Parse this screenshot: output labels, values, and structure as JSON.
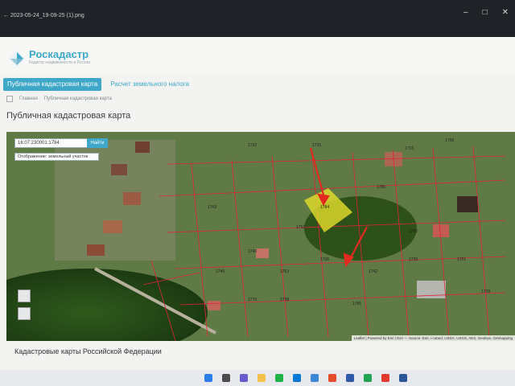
{
  "window": {
    "filename": "← 2023-05-24_19-09-25 (1).png"
  },
  "header": {
    "brand": "Роскадастр",
    "brand_sub": "Кадастр недвижимости в России"
  },
  "tabs": [
    {
      "label": "Публичная кадастровая карта",
      "active": true
    },
    {
      "label": "Расчет земельного налога",
      "active": false
    }
  ],
  "breadcrumb": {
    "home": "Главная",
    "current": "Публичная кадастровая карта"
  },
  "page_title": "Публичная кадастровая карта",
  "map": {
    "search_value": "16:07:230001:1784",
    "find_label": "Найти",
    "select_value": "Отображение: земельный участок",
    "parcel_labels": [
      "1722",
      "1725",
      "1716",
      "1768",
      "1784",
      "1752",
      "1706",
      "1740",
      "1763",
      "1746",
      "1738",
      "1742",
      "1700",
      "1721",
      "1739",
      "1743",
      "1770",
      "1781",
      "1709",
      "1786"
    ],
    "highlight_color": "#e3e02b",
    "boundary_color": "#e0243a",
    "arrow_color": "#e22a1f",
    "attribution": "Leaflet | Powered by Esri | Esri — Source: Esri, i-cubed, USDA, USGS, AEX, GeoEye, Getmapping"
  },
  "footer_caption": "Кадастровые карты Российской Федерации"
}
